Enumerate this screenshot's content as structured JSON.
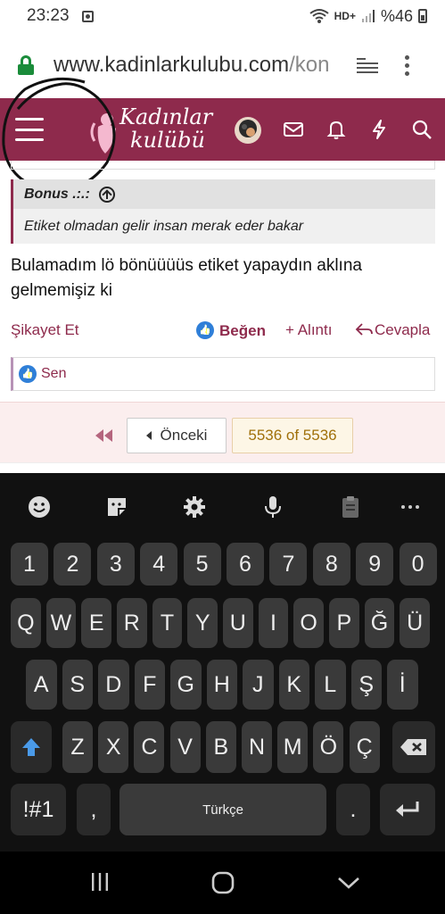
{
  "status_bar": {
    "time": "23:23",
    "network": "HD+",
    "battery": "%46"
  },
  "browser": {
    "url_main": "www.kadinlarkulubu.com",
    "url_rest": "/kon"
  },
  "site": {
    "logo_line1": "Kadınlar",
    "logo_line2": "kulübü"
  },
  "quote": {
    "author": "Bonus .:.:",
    "text": "Etiket olmadan gelir insan merak eder bakar"
  },
  "post": {
    "text": "Bulamadım lö bönüüüüs etiket yapaydın aklına gelmemişiz ki"
  },
  "actions": {
    "report": "Şikayet Et",
    "like": "Beğen",
    "quote": "+ Alıntı",
    "reply": "Cevapla"
  },
  "likes": {
    "text": "Sen"
  },
  "pagination": {
    "prev": "Önceki",
    "current": "5536 of 5536"
  },
  "keyboard": {
    "row_numbers": [
      "1",
      "2",
      "3",
      "4",
      "5",
      "6",
      "7",
      "8",
      "9",
      "0"
    ],
    "row1": [
      "Q",
      "W",
      "E",
      "R",
      "T",
      "Y",
      "U",
      "I",
      "O",
      "P",
      "Ğ",
      "Ü"
    ],
    "row2": [
      "A",
      "S",
      "D",
      "F",
      "G",
      "H",
      "J",
      "K",
      "L",
      "Ş",
      "İ"
    ],
    "row3": [
      "Z",
      "X",
      "C",
      "V",
      "B",
      "N",
      "M",
      "Ö",
      "Ç"
    ],
    "symbols": "!#1",
    "comma": ",",
    "space": "Türkçe",
    "period": "."
  },
  "colors": {
    "brand": "#8e2a4c",
    "keyboard_bg": "#111111",
    "key_bg": "#3a3a3a",
    "shift_accent": "#4a9ae8"
  }
}
